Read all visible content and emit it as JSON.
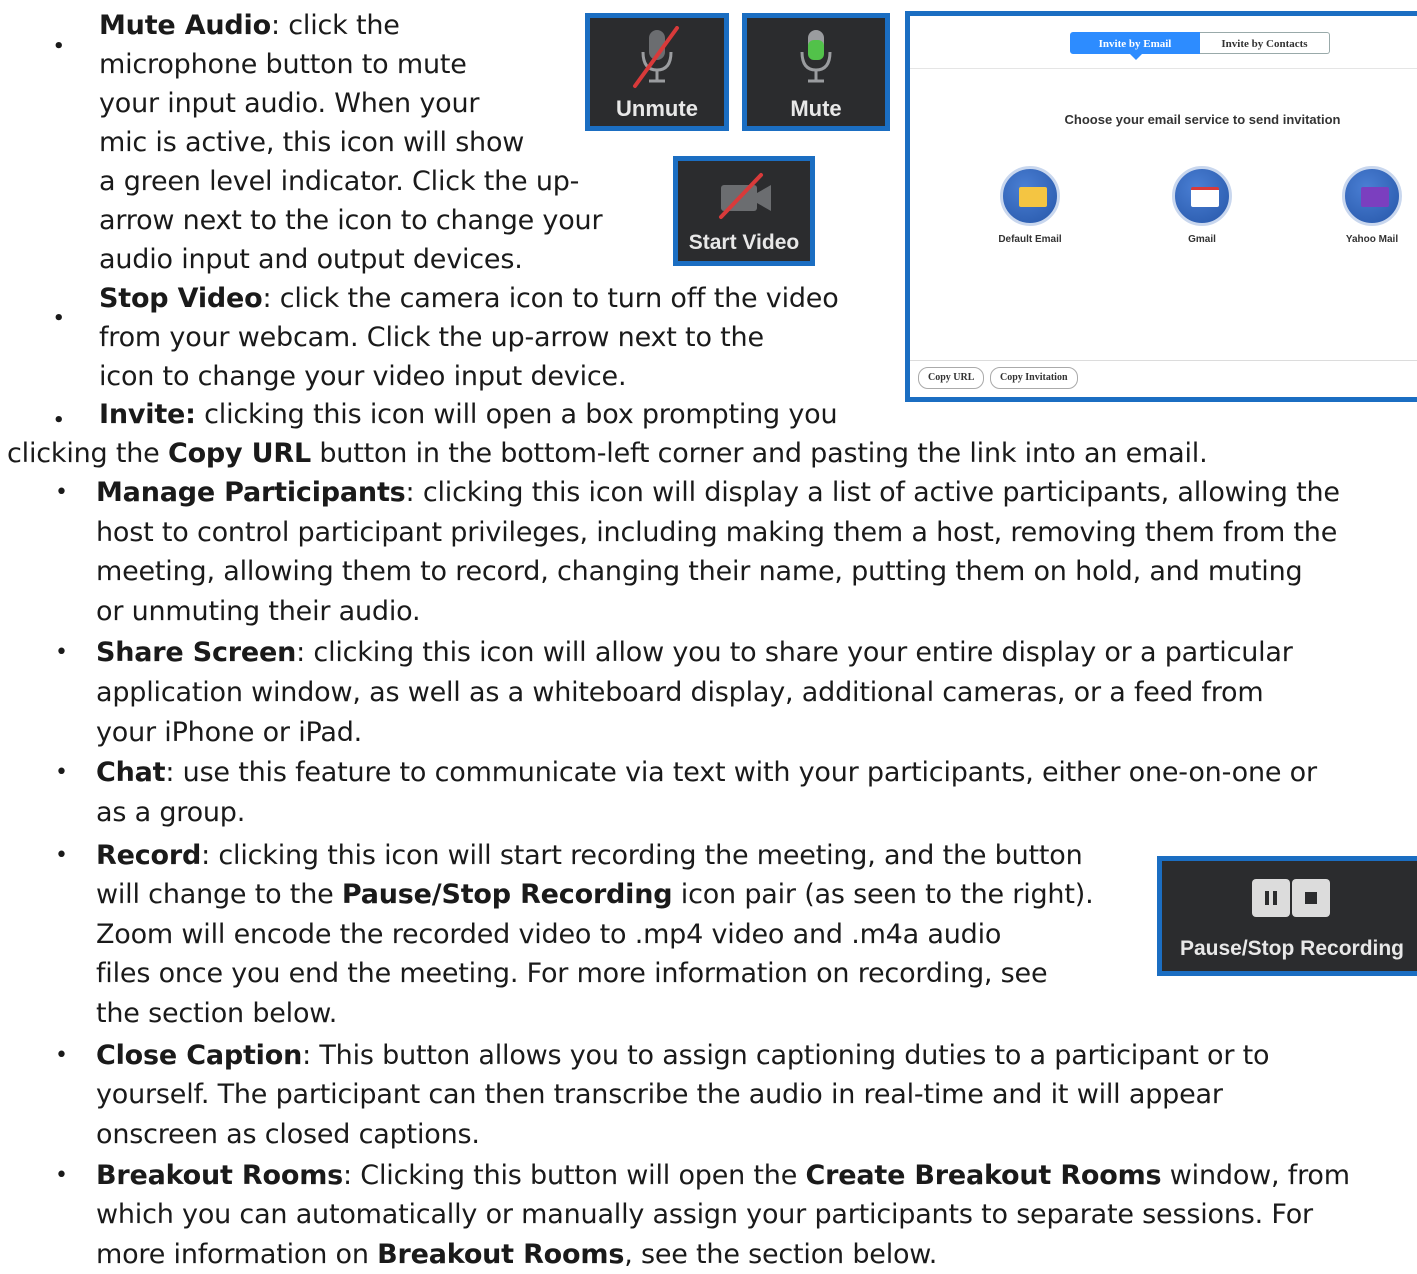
{
  "mute_audio": {
    "title": "Mute Audio",
    "lines": [
      ": click the",
      "microphone button to mute",
      "your input audio. When your",
      "mic is active, this icon will show",
      "a green level indicator. Click the up-",
      "arrow next to the icon to change your",
      "audio input and output devices."
    ]
  },
  "stop_video": {
    "title": "Stop Video",
    "lines": [
      ": click the camera icon to turn off the video",
      "from your webcam. Click the up-arrow next to the",
      "icon to change your video input device."
    ]
  },
  "invite": {
    "title": "Invite:",
    "line1": " clicking this icon will open a box prompting you",
    "line2_pre": "clicking the ",
    "line2_bold": "Copy URL",
    "line2_post": " button in the bottom-left corner and pasting the link into an email."
  },
  "manage_participants": {
    "title": "Manage Participants",
    "lines": [
      ": clicking this icon will display a list of active participants, allowing the",
      "host to control participant privileges, including making them a host, removing them from the",
      "meeting, allowing them to record, changing their name, putting them on hold, and muting",
      "or unmuting their audio."
    ]
  },
  "share_screen": {
    "title": "Share Screen",
    "lines": [
      ": clicking this icon will allow you to share your entire display or a particular",
      "application window, as well as a whiteboard display, additional cameras, or a feed from",
      "your iPhone or iPad."
    ]
  },
  "chat": {
    "title": "Chat",
    "lines": [
      ": use this feature to communicate via text with your participants, either one-on-one or",
      "as a group."
    ]
  },
  "record": {
    "title": "Record",
    "line1": ": clicking this icon will start recording the meeting, and the button",
    "line2_pre": "will change to the ",
    "line2_bold": "Pause/Stop Recording",
    "line2_post": " icon pair (as seen to the right).",
    "lines_rest": [
      "Zoom will encode the recorded video to .mp4 video and .m4a audio",
      "files once you end the meeting. For more information on recording, see",
      "the section below."
    ]
  },
  "close_caption": {
    "title": "Close Caption",
    "lines": [
      ": This button allows you to assign captioning duties to a participant or to",
      "yourself. The participant can then transcribe the audio in real-time and it will appear",
      "onscreen as closed captions."
    ]
  },
  "breakout_rooms": {
    "title": "Breakout Rooms",
    "l1_pre": ": Clicking this button will open the ",
    "l1_bold": "Create Breakout Rooms",
    "l1_post": " window, from",
    "line2": "which you can automatically or manually assign your participants to separate sessions. For",
    "l3_pre": "more information on ",
    "l3_bold": "Breakout Rooms",
    "l3_post": ", see the section below."
  },
  "bullet_char": "•",
  "dot_char": "•",
  "buttons": {
    "unmute": "Unmute",
    "mute": "Mute",
    "start_video": "Start Video",
    "pause_stop": "Pause/Stop Recording"
  },
  "dialog": {
    "tab_email": "Invite by Email",
    "tab_contacts": "Invite by Contacts",
    "title": "Choose your email service to send invitation",
    "services": [
      "Default Email",
      "Gmail",
      "Yahoo Mail"
    ],
    "copy_url": "Copy URL",
    "copy_invitation": "Copy Invitation"
  },
  "colors": {
    "button_frame": "#1b6ec2",
    "button_bg": "#2b2c2e",
    "mic_green": "#52c24a",
    "slash_red": "#d83a3a",
    "zoom_blue": "#2d8cff"
  }
}
